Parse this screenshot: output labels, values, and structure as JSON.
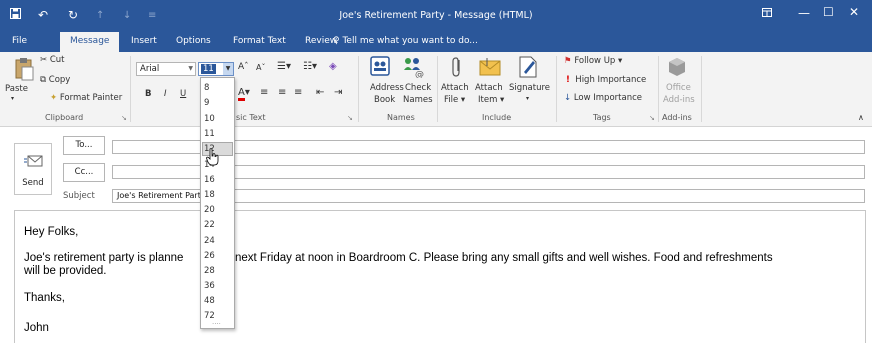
{
  "window": {
    "title": "Joe's Retirement Party - Message (HTML)"
  },
  "tabs": {
    "file": "File",
    "message": "Message",
    "insert": "Insert",
    "options": "Options",
    "format_text": "Format Text",
    "review": "Review",
    "tell_me": "Tell me what you want to do..."
  },
  "ribbon": {
    "clipboard": {
      "paste": "Paste",
      "cut": "Cut",
      "copy": "Copy",
      "format_painter": "Format Painter",
      "label": "Clipboard"
    },
    "basic_text": {
      "font_name": "Arial",
      "font_size": "11",
      "label": "Basic Text",
      "label_visible": "sic Text"
    },
    "names": {
      "address_book_1": "Address",
      "address_book_2": "Book",
      "check_names_1": "Check",
      "check_names_2": "Names",
      "label": "Names"
    },
    "include": {
      "attach_file_1": "Attach",
      "attach_file_2": "File",
      "attach_item_1": "Attach",
      "attach_item_2": "Item",
      "signature": "Signature",
      "label": "Include"
    },
    "tags": {
      "follow_up": "Follow Up",
      "high_importance": "High Importance",
      "low_importance": "Low Importance",
      "label": "Tags"
    },
    "addins": {
      "office_1": "Office",
      "office_2": "Add-ins",
      "label": "Add-ins"
    }
  },
  "compose": {
    "send": "Send",
    "to_button": "To...",
    "cc_button": "Cc...",
    "subject_label": "Subject",
    "subject_value": "Joe's Retirement Party"
  },
  "body": {
    "greeting": "Hey Folks,",
    "line1_a": "Joe's retirement party is planne",
    "line1_b": "next Friday at noon in Boardroom C. Please bring any small gifts and well wishes. Food and refreshments",
    "line2": "will be provided.",
    "thanks": "Thanks,",
    "signature": "John"
  },
  "font_size_dropdown": {
    "options": [
      "8",
      "9",
      "10",
      "11",
      "12",
      "14",
      "16",
      "18",
      "20",
      "22",
      "24",
      "26",
      "28",
      "36",
      "48",
      "72"
    ],
    "hovered": "12"
  },
  "colors": {
    "accent": "#2b579a",
    "ribbon_bg": "#f3f3f3"
  }
}
